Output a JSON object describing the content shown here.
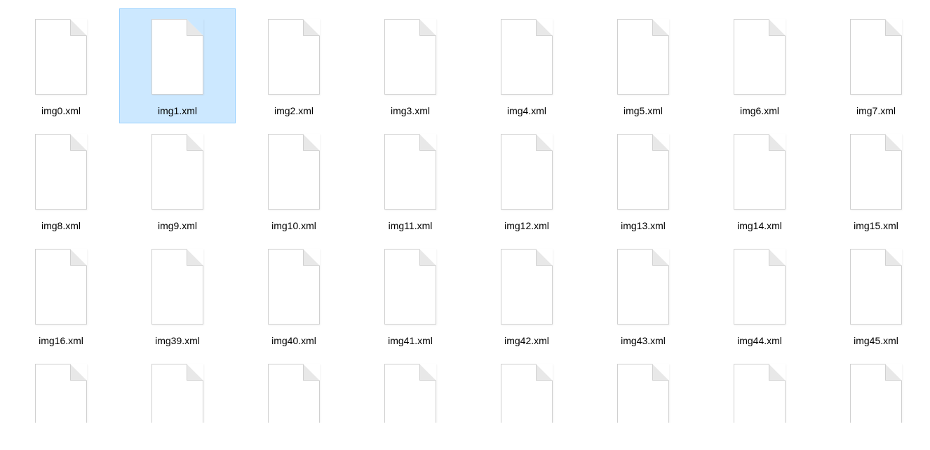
{
  "selected_index": 1,
  "files": [
    {
      "name": "img0.xml"
    },
    {
      "name": "img1.xml"
    },
    {
      "name": "img2.xml"
    },
    {
      "name": "img3.xml"
    },
    {
      "name": "img4.xml"
    },
    {
      "name": "img5.xml"
    },
    {
      "name": "img6.xml"
    },
    {
      "name": "img7.xml"
    },
    {
      "name": "img8.xml"
    },
    {
      "name": "img9.xml"
    },
    {
      "name": "img10.xml"
    },
    {
      "name": "img11.xml"
    },
    {
      "name": "img12.xml"
    },
    {
      "name": "img13.xml"
    },
    {
      "name": "img14.xml"
    },
    {
      "name": "img15.xml"
    },
    {
      "name": "img16.xml"
    },
    {
      "name": "img39.xml"
    },
    {
      "name": "img40.xml"
    },
    {
      "name": "img41.xml"
    },
    {
      "name": "img42.xml"
    },
    {
      "name": "img43.xml"
    },
    {
      "name": "img44.xml"
    },
    {
      "name": "img45.xml"
    },
    {
      "name": ""
    },
    {
      "name": ""
    },
    {
      "name": ""
    },
    {
      "name": ""
    },
    {
      "name": ""
    },
    {
      "name": ""
    },
    {
      "name": ""
    },
    {
      "name": ""
    }
  ]
}
